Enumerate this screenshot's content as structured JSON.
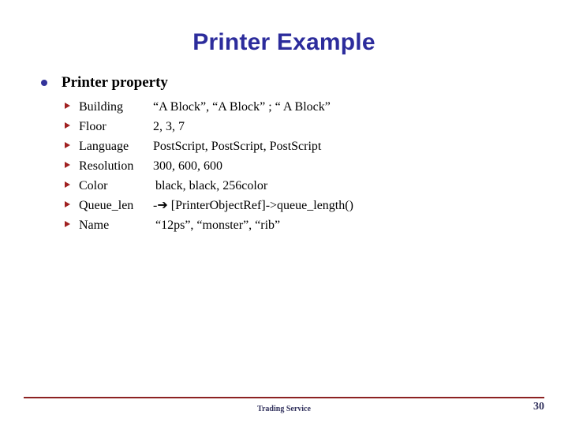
{
  "slide": {
    "title": "Printer Example",
    "title_color": "#2C2C9C",
    "background_color": "#ffffff"
  },
  "bullets": {
    "level1": {
      "label": "Printer property",
      "bullet_color": "#33339A"
    },
    "marker_color": "#A02020",
    "rows": [
      {
        "label": "Building",
        "value": "“A Block”, “A Block” ; “ A Block”"
      },
      {
        "label": "Floor",
        "value": "2, 3, 7"
      },
      {
        "label": "Language",
        "value": "PostScript, PostScript, PostScript"
      },
      {
        "label": "Resolution",
        "value": "300, 600, 600"
      },
      {
        "label": "Color",
        "value": "black, black, 256color"
      },
      {
        "label": "Queue_len",
        "value": "-➔ [PrinterObjectRef]->queue_length()"
      },
      {
        "label": "Name",
        "value": "“12ps”, “monster”, “rib”"
      }
    ]
  },
  "footer": {
    "center_text": "Trading Service",
    "page_number": "30",
    "rule_color": "#8C2222",
    "text_color": "#33335E"
  }
}
